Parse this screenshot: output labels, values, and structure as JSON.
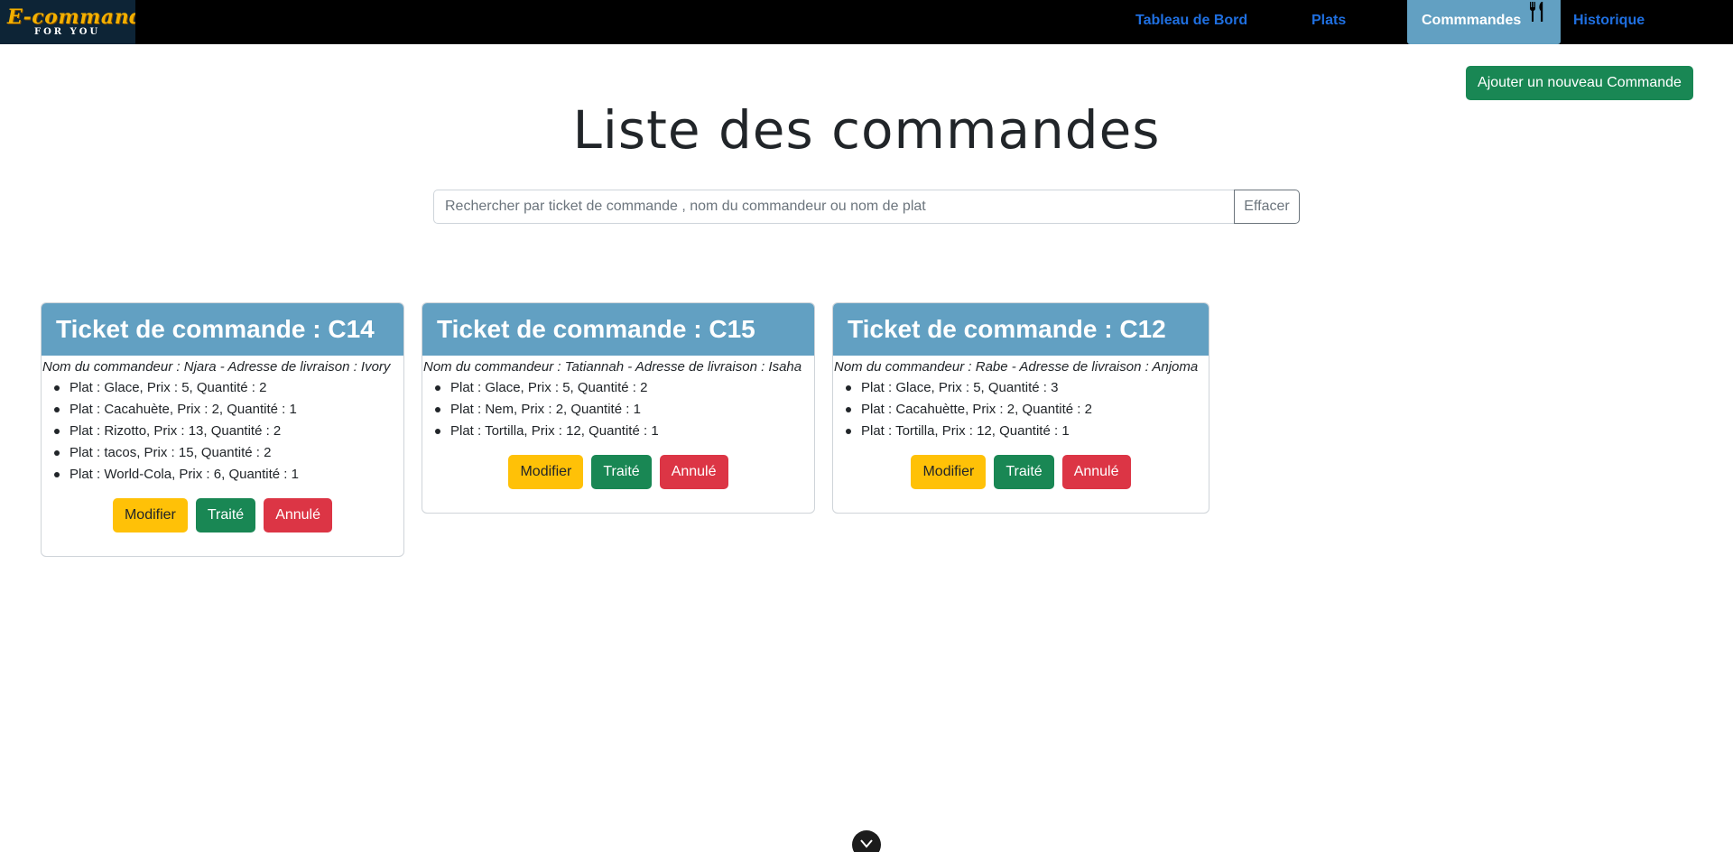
{
  "logo": {
    "main": "E-commande",
    "sub": "FOR YOU"
  },
  "nav": {
    "items": [
      {
        "label": "Tableau de Bord"
      },
      {
        "label": "Plats"
      },
      {
        "label": "Commmandes"
      },
      {
        "label": "Historique"
      }
    ],
    "active": "Commmandes"
  },
  "colors": {
    "nav_bg": "#000000",
    "nav_link": "#1f6fe0",
    "nav_active": "#62a0c2",
    "card_header": "#62a0c2",
    "success": "#198754",
    "warning": "#ffc107",
    "danger": "#dc3545"
  },
  "add_button": "Ajouter un nouveau Commande",
  "page_title": "Liste des commandes",
  "search": {
    "placeholder": "Rechercher par ticket de commande , nom du commandeur ou nom de plat",
    "value": "",
    "clear_label": "Effacer"
  },
  "cards": [
    {
      "title": "Ticket de commande : C14",
      "info": "Nom du commandeur : Njara - Adresse de livraison : Ivory",
      "items": [
        "Plat : Glace, Prix : 5, Quantité : 2",
        "Plat : Cacahuète, Prix : 2, Quantité : 1",
        "Plat : Rizotto, Prix : 13, Quantité : 2",
        "Plat : tacos, Prix : 15, Quantité : 2",
        "Plat : World-Cola, Prix : 6, Quantité : 1"
      ],
      "buttons": {
        "edit": "Modifier",
        "done": "Traité",
        "cancel": "Annulé"
      }
    },
    {
      "title": "Ticket de commande : C15",
      "info": "Nom du commandeur : Tatiannah - Adresse de livraison : Isaha",
      "items": [
        "Plat : Glace, Prix : 5, Quantité : 2",
        "Plat : Nem, Prix : 2, Quantité : 1",
        "Plat : Tortilla, Prix : 12, Quantité : 1"
      ],
      "buttons": {
        "edit": "Modifier",
        "done": "Traité",
        "cancel": "Annulé"
      }
    },
    {
      "title": "Ticket de commande : C12",
      "info": "Nom du commandeur : Rabe - Adresse de livraison : Anjoma",
      "items": [
        "Plat : Glace, Prix : 5, Quantité : 3",
        "Plat : Cacahuètte, Prix : 2, Quantité : 2",
        "Plat : Tortilla, Prix : 12, Quantité : 1"
      ],
      "buttons": {
        "edit": "Modifier",
        "done": "Traité",
        "cancel": "Annulé"
      }
    }
  ]
}
